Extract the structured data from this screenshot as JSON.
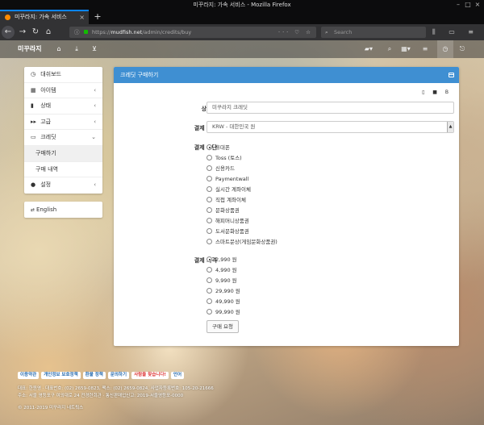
{
  "browser": {
    "window_title": "미꾸라지: 가속 서비스 - Mozilla Firefox",
    "tab_title": "미꾸라지: 가속 서비스",
    "url_scheme": "https://",
    "url_host": "mudfish.net",
    "url_path": "/admin/credits/buy",
    "url_actions": "··· ♡ ☆",
    "search_placeholder": "Search",
    "right_icons": "⫼ ▭ ≡"
  },
  "appbar": {
    "brand": "미꾸라지"
  },
  "sidebar": {
    "items": [
      {
        "label": "대쉬보드",
        "icon": "◷"
      },
      {
        "label": "아이템",
        "icon": "▦",
        "chev": "‹"
      },
      {
        "label": "상태",
        "icon": "▮",
        "chev": "‹"
      },
      {
        "label": "고급",
        "icon": "▸▸",
        "chev": "‹"
      },
      {
        "label": "크레딧",
        "icon": "▭",
        "chev": "⌄"
      },
      {
        "label": "구매하기"
      },
      {
        "label": "구매 내역"
      },
      {
        "label": "설정",
        "icon": "●",
        "chev": "‹"
      }
    ],
    "language": "English"
  },
  "panel": {
    "title": "크레딧 구매하기",
    "sizer": "▯ ■ B",
    "product_label": "상품명",
    "product_value": "미꾸라지 크레딧",
    "currency_label": "결제 통화",
    "currency_value": "KRW - 대한민국 원",
    "method_label": "결제 수단",
    "methods": [
      {
        "label": "휴대폰",
        "selected": true
      },
      {
        "label": "Toss (토스)",
        "selected": false
      },
      {
        "label": "신용카드",
        "selected": false
      },
      {
        "label": "Paymentwall",
        "selected": false
      },
      {
        "label": "실시간 계좌이체",
        "selected": false
      },
      {
        "label": "직접 계좌이체",
        "selected": false
      },
      {
        "label": "문화상품권",
        "selected": false
      },
      {
        "label": "해피머니상품권",
        "selected": false
      },
      {
        "label": "도서문화상품권",
        "selected": false
      },
      {
        "label": "스마트문상(게임문화상품권)",
        "selected": false
      }
    ],
    "price_label": "결제 가격",
    "prices": [
      {
        "label": "2,990 원",
        "selected": true
      },
      {
        "label": "4,990 원",
        "selected": false
      },
      {
        "label": "9,990 원",
        "selected": false
      },
      {
        "label": "29,990 원",
        "selected": false
      },
      {
        "label": "49,990 원",
        "selected": false
      },
      {
        "label": "99,990 원",
        "selected": false
      }
    ],
    "submit_label": "구매 요청"
  },
  "footer": {
    "links": [
      "이용약관",
      "개인정보 보호정책",
      "환불 정책",
      "문의하기",
      "사람을 찾습니다!",
      "언어"
    ],
    "line1": "대표: 한원영 · 대표번호: (02) 2659-0823, 팩스: (02) 2659-0824, 사업자등록번호: 105-20-21666",
    "line2": "주소: 서울 영등포구 여의대로 24 전경련회관 · 통신판매업신고: 2019-서울영등포-0000",
    "line3": "© 2011-2019 미꾸라지 네트웍스"
  }
}
